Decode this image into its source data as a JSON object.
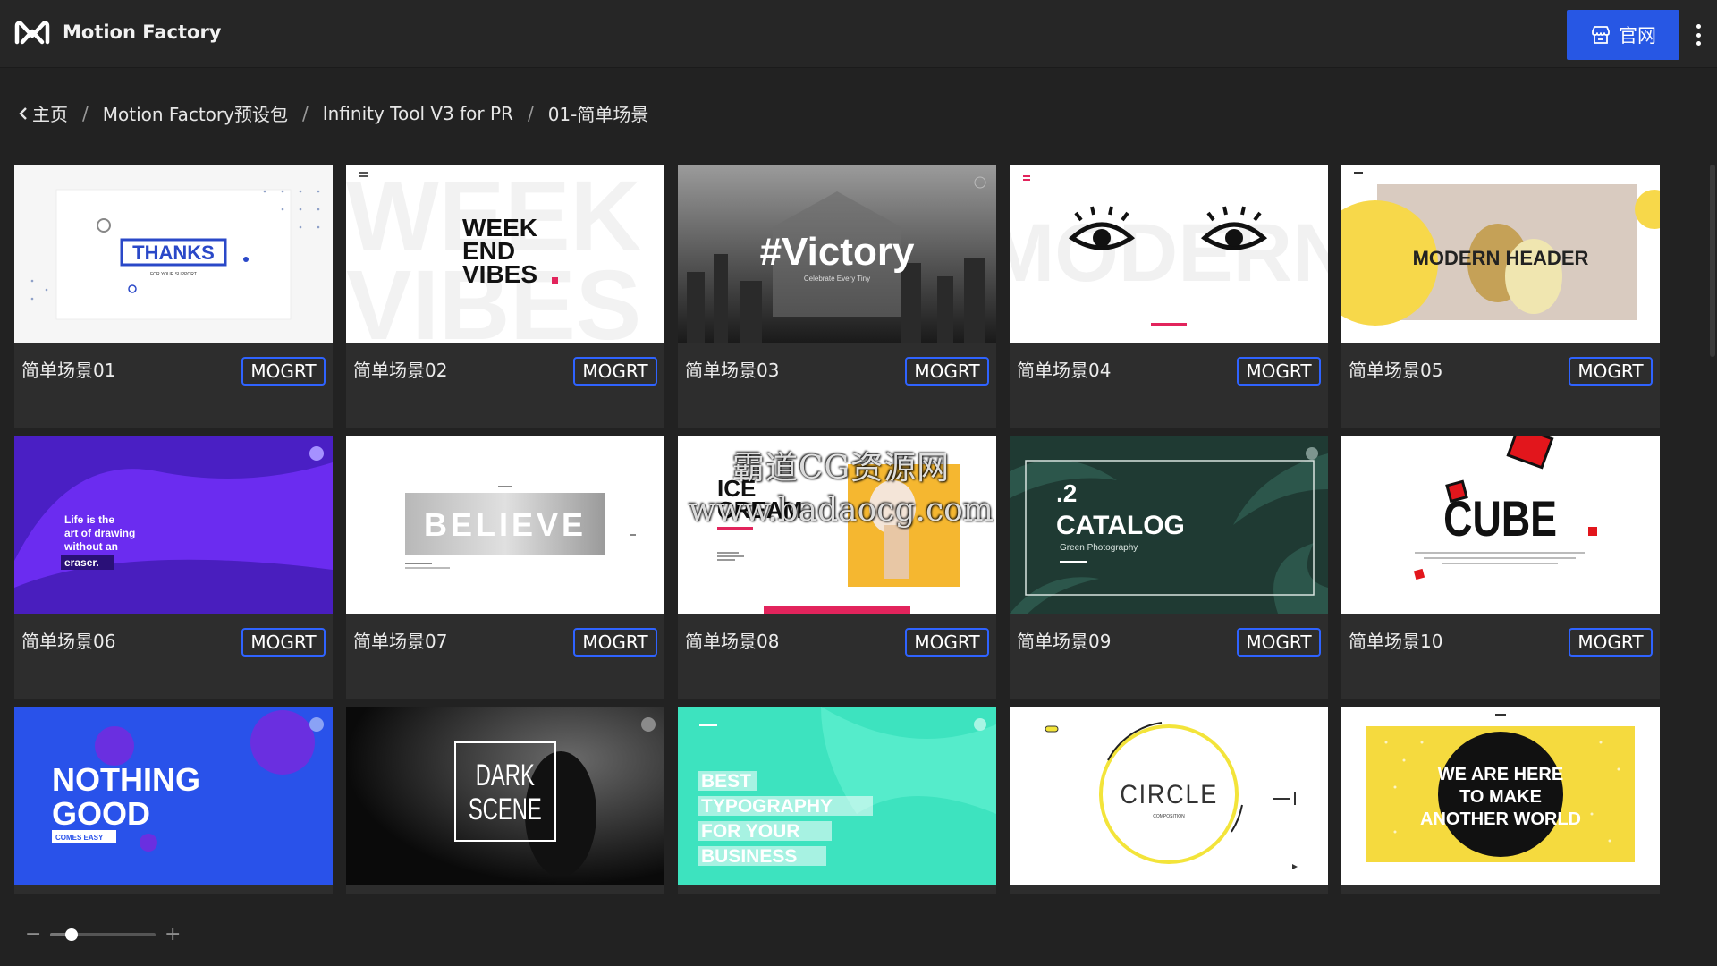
{
  "app": {
    "title": "Motion Factory",
    "home_button_label": "官网",
    "accent_color": "#2757e4"
  },
  "breadcrumb": [
    {
      "label": "主页",
      "back": true
    },
    {
      "label": "Motion Factory预设包"
    },
    {
      "label": "Infinity Tool V3 for PR"
    },
    {
      "label": "01-简单场景"
    }
  ],
  "badge_label": "MOGRT",
  "cards": [
    {
      "name": "简单场景01",
      "thumb_text": "THANKS",
      "thumb_sub": "FOR YOUR SUPPORT"
    },
    {
      "name": "简单场景02",
      "thumb_text": "WEEK END VIBES",
      "thumb_sub": ""
    },
    {
      "name": "简单场景03",
      "thumb_text": "#Victory",
      "thumb_sub": "Celebrate Every Tiny"
    },
    {
      "name": "简单场景04",
      "thumb_text": "MODERN",
      "thumb_sub": ""
    },
    {
      "name": "简单场景05",
      "thumb_text": "MODERN HEADER",
      "thumb_sub": ""
    },
    {
      "name": "简单场景06",
      "thumb_text": "Life is the art of drawing without an eraser.",
      "thumb_sub": ""
    },
    {
      "name": "简单场景07",
      "thumb_text": "BELIEVE",
      "thumb_sub": ""
    },
    {
      "name": "简单场景08",
      "thumb_text": "ICE CREAM",
      "thumb_sub": ""
    },
    {
      "name": "简单场景09",
      "thumb_text": ".2 CATALOG",
      "thumb_sub": "Green Photography"
    },
    {
      "name": "简单场景10",
      "thumb_text": "CUBE",
      "thumb_sub": ""
    },
    {
      "name": "",
      "thumb_text": "NOTHING GOOD",
      "thumb_sub": "COMES EASY"
    },
    {
      "name": "",
      "thumb_text": "DARK SCENE",
      "thumb_sub": ""
    },
    {
      "name": "",
      "thumb_text": "BEST TYPOGRAPHY FOR YOUR BUSINESS",
      "thumb_sub": ""
    },
    {
      "name": "",
      "thumb_text": "CIRCLE",
      "thumb_sub": "COMPOSITION"
    },
    {
      "name": "",
      "thumb_text": "WE ARE HERE TO MAKE ANOTHER WORLD",
      "thumb_sub": ""
    }
  ],
  "zoom": {
    "minus": "−",
    "plus": "+",
    "level": 0.2
  },
  "watermark": {
    "line1": "霸道CG资源网",
    "line2": "www.badaocg.com"
  }
}
